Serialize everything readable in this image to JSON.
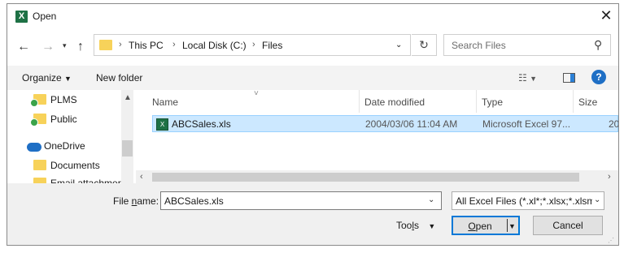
{
  "window": {
    "title": "Open",
    "app_icon": "X"
  },
  "address": {
    "crumbs": [
      "This PC",
      "Local Disk (C:)",
      "Files"
    ],
    "search_placeholder": "Search Files"
  },
  "toolbar": {
    "organize": "Organize",
    "new_folder": "New folder",
    "help": "?"
  },
  "sidebar": {
    "items": [
      {
        "label": "PLMS",
        "icon": "user-folder-icon"
      },
      {
        "label": "Public",
        "icon": "user-folder-icon"
      },
      {
        "label": "OneDrive",
        "icon": "onedrive-cloud-icon"
      },
      {
        "label": "Documents",
        "icon": "folder-icon"
      },
      {
        "label": "Email attachmer",
        "icon": "folder-icon"
      }
    ]
  },
  "list": {
    "columns": [
      "Name",
      "Date modified",
      "Type",
      "Size"
    ],
    "rows": [
      {
        "name": "ABCSales.xls",
        "date": "2004/03/06 11:04 AM",
        "type": "Microsoft Excel 97...",
        "size": "20"
      }
    ]
  },
  "footer": {
    "file_name_label_pre": "File ",
    "file_name_label_u": "n",
    "file_name_label_post": "ame:",
    "file_name_value": "ABCSales.xls",
    "filter_value": "All Excel Files (*.xl*;*.xlsx;*.xlsm",
    "tools_pre": "Too",
    "tools_u": "l",
    "tools_post": "s",
    "open_u": "O",
    "open_post": "pen",
    "cancel": "Cancel"
  },
  "colors": {
    "accent": "#0078d7",
    "selection": "#cce8ff",
    "excel": "#1e7145",
    "help": "#1f6fc5"
  }
}
